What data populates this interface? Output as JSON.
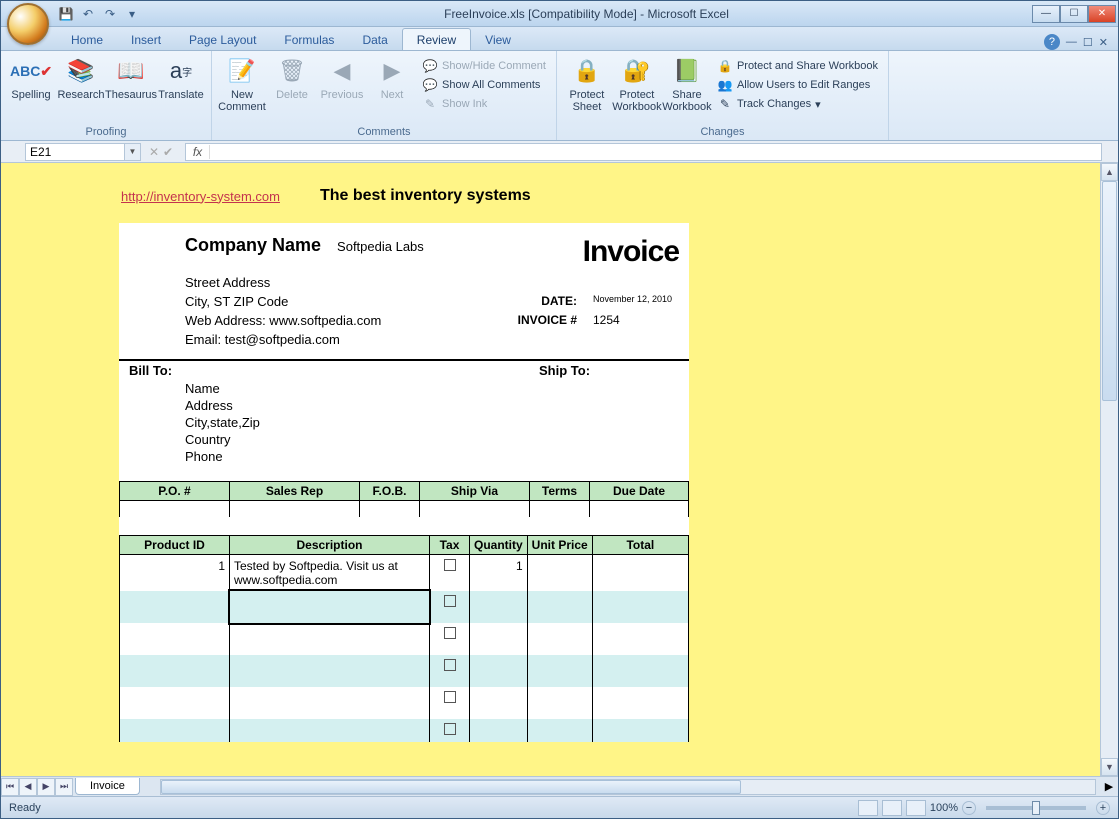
{
  "title": "FreeInvoice.xls  [Compatibility Mode] - Microsoft Excel",
  "tabs": [
    "Home",
    "Insert",
    "Page Layout",
    "Formulas",
    "Data",
    "Review",
    "View"
  ],
  "active_tab": "Review",
  "ribbon": {
    "proofing": {
      "label": "Proofing",
      "spelling": "Spelling",
      "research": "Research",
      "thesaurus": "Thesaurus",
      "translate": "Translate"
    },
    "comments": {
      "label": "Comments",
      "new_comment": "New Comment",
      "delete": "Delete",
      "previous": "Previous",
      "next": "Next",
      "show_hide": "Show/Hide Comment",
      "show_all": "Show All Comments",
      "show_ink": "Show Ink"
    },
    "changes": {
      "label": "Changes",
      "protect_sheet": "Protect Sheet",
      "protect_workbook": "Protect Workbook",
      "share_workbook": "Share Workbook",
      "protect_share": "Protect and Share Workbook",
      "allow_users": "Allow Users to Edit Ranges",
      "track_changes": "Track Changes"
    }
  },
  "name_box": "E21",
  "top_link": "http://inventory-system.com",
  "top_tag": "The best inventory systems",
  "invoice": {
    "company": "Company Name",
    "softpedia": "Softpedia Labs",
    "title": "Invoice",
    "street": "Street Address",
    "city": "City, ST  ZIP Code",
    "web": "Web Address: www.softpedia.com",
    "email": "Email: test@softpedia.com",
    "date_label": "DATE:",
    "date_value": "November 12, 2010",
    "invno_label": "INVOICE #",
    "invno_value": "1254",
    "bill_to": "Bill To:",
    "ship_to": "Ship To:",
    "bill_lines": [
      "Name",
      "Address",
      "City,state,Zip",
      "Country",
      "Phone"
    ]
  },
  "po_headers": [
    "P.O. #",
    "Sales Rep",
    "F.O.B.",
    "Ship Via",
    "Terms",
    "Due Date"
  ],
  "prod_headers": [
    "Product ID",
    "Description",
    "Tax",
    "Quantity",
    "Unit Price",
    "Total"
  ],
  "prod_row1": {
    "id": "1",
    "desc": "Tested by Softpedia. Visit us at www.softpedia.com",
    "qty": "1"
  },
  "sheet_tab": "Invoice",
  "status": "Ready",
  "zoom": "100%"
}
